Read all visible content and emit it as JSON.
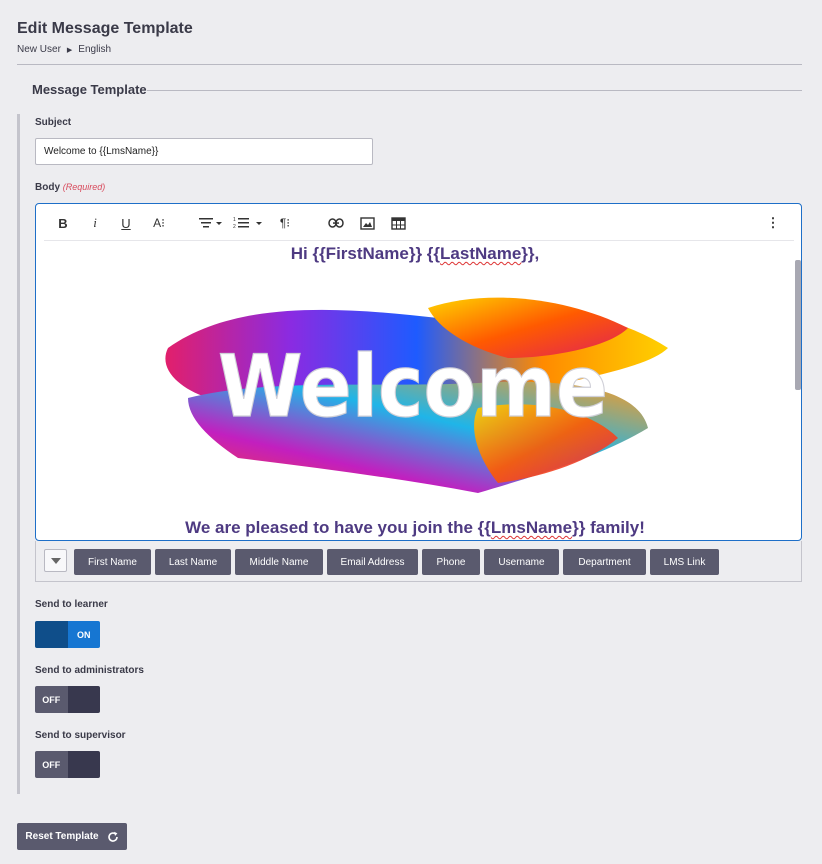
{
  "page": {
    "title": "Edit Message Template",
    "breadcrumb": [
      "New User",
      "English"
    ]
  },
  "section": {
    "legend": "Message Template"
  },
  "subject": {
    "label": "Subject",
    "value": "Welcome to {{LmsName}}"
  },
  "body": {
    "label": "Body",
    "required_text": "(Required)",
    "greeting_prefix": "Hi ",
    "greeting_first": "{{FirstName}}",
    "greeting_mid": " {{",
    "greeting_last": "LastName",
    "greeting_end": "}},",
    "image_text": "Welcome",
    "line_prefix": "We are pleased to have you join the {{",
    "line_token": "LmsName",
    "line_suffix": "}} family!"
  },
  "toolbar": {
    "icons": [
      "bold-icon",
      "italic-icon",
      "underline-icon",
      "font-size-icon",
      "align-icon",
      "list-icon",
      "paragraph-icon",
      "link-icon",
      "image-icon",
      "table-icon",
      "more-icon"
    ]
  },
  "tokens": [
    "First Name",
    "Last Name",
    "Middle Name",
    "Email Address",
    "Phone",
    "Username",
    "Department",
    "LMS Link"
  ],
  "send_learner": {
    "label": "Send to learner",
    "state": "ON"
  },
  "send_admins": {
    "label": "Send to administrators",
    "state": "OFF"
  },
  "send_supervisor": {
    "label": "Send to supervisor",
    "state": "OFF"
  },
  "reset": {
    "label": "Reset Template"
  },
  "colors": {
    "accent": "#1676d2",
    "text_purple": "#4e3a82",
    "button": "#5a5a6e"
  }
}
